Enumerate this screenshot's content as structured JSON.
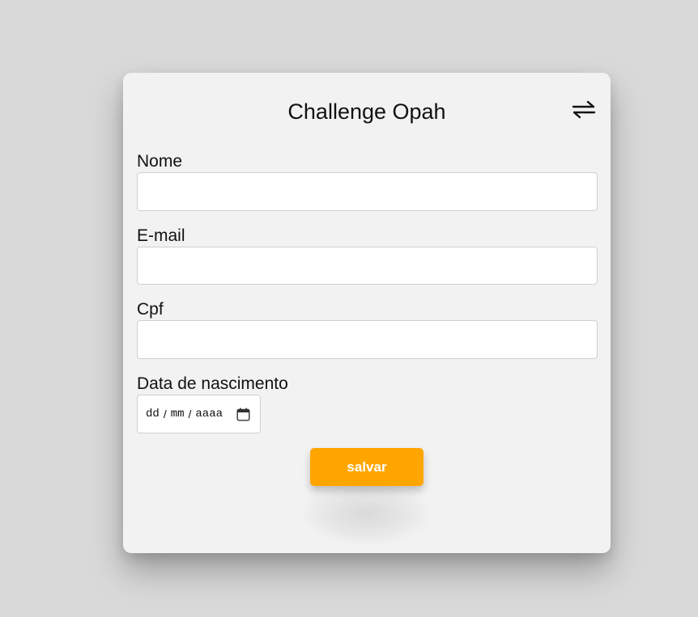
{
  "header": {
    "title": "Challenge Opah",
    "toggle_icon": "swap-arrows-icon"
  },
  "form": {
    "nome": {
      "label": "Nome",
      "value": ""
    },
    "email": {
      "label": "E-mail",
      "value": ""
    },
    "cpf": {
      "label": "Cpf",
      "value": ""
    },
    "birthdate": {
      "label": "Data de nascimento",
      "day_placeholder": "dd",
      "month_placeholder": "mm",
      "year_placeholder": "aaaa",
      "separator": "/",
      "icon": "calendar-icon"
    },
    "submit_label": "salvar"
  },
  "colors": {
    "accent": "#ffa500",
    "card_bg": "#f2f2f2",
    "page_bg": "#d9d9d9"
  }
}
